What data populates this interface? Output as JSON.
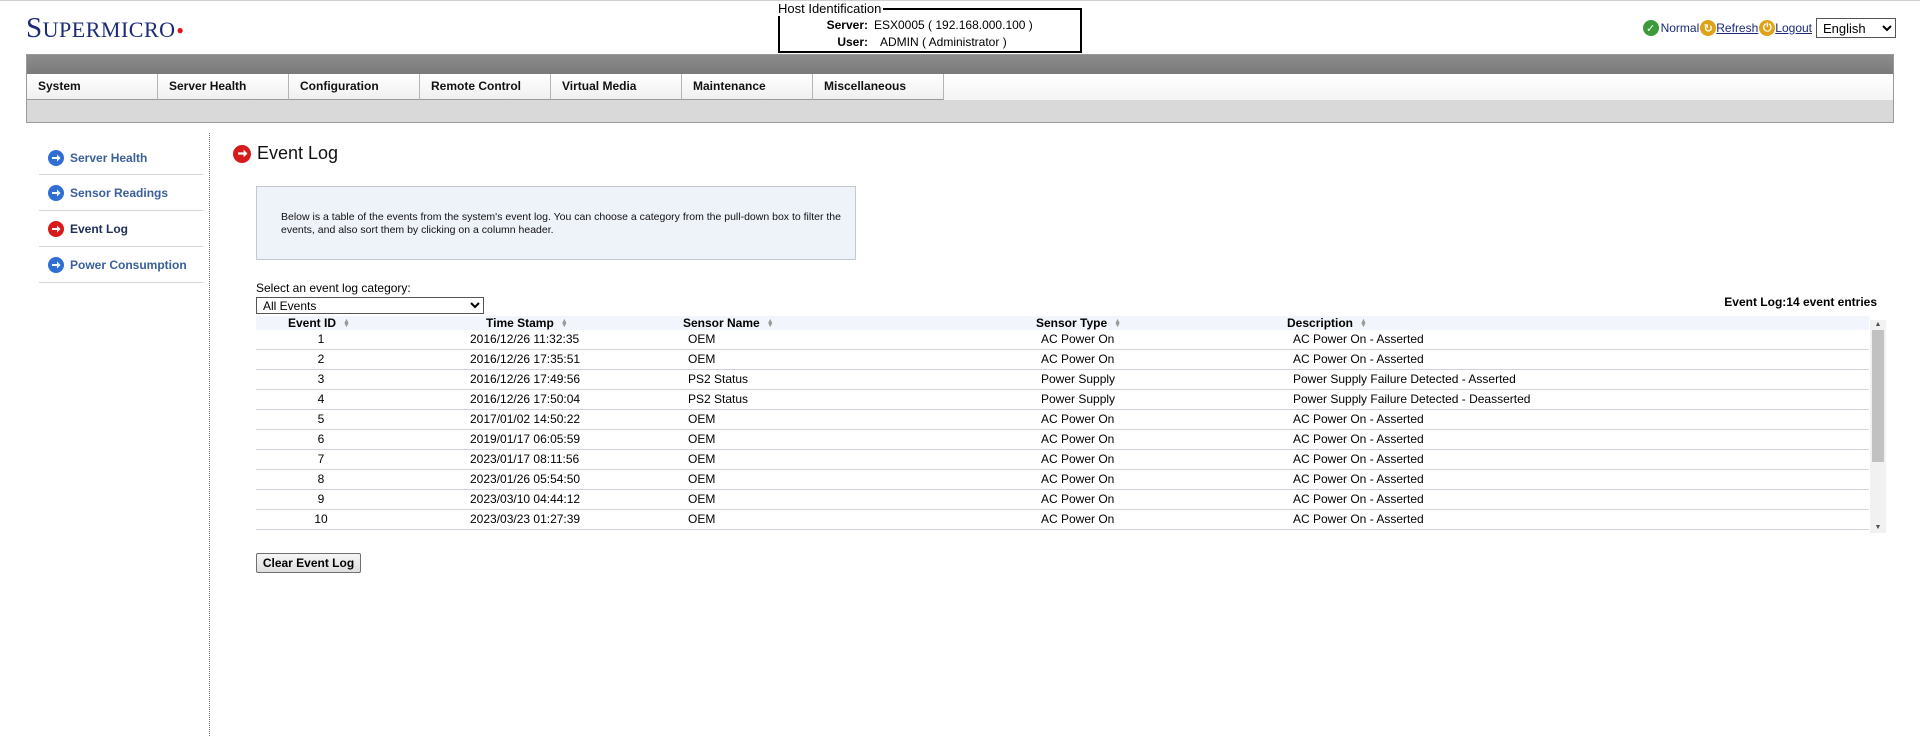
{
  "header": {
    "logo_text": "SUPERMICRO",
    "host": {
      "legend": "Host Identification",
      "server_label": "Server:",
      "server_value": "ESX0005  ( 192.168.000.100 )",
      "user_label": "User:",
      "user_value": "ADMIN      ( Administrator )"
    },
    "status_label": "Normal",
    "refresh_label": "Refresh",
    "logout_label": "Logout",
    "language": "English"
  },
  "nav": {
    "tabs": [
      "System",
      "Server Health",
      "Configuration",
      "Remote Control",
      "Virtual Media",
      "Maintenance",
      "Miscellaneous"
    ]
  },
  "sidebar": {
    "items": [
      {
        "label": "Server Health",
        "active": false
      },
      {
        "label": "Sensor Readings",
        "active": false
      },
      {
        "label": "Event Log",
        "active": true
      },
      {
        "label": "Power Consumption",
        "active": false
      }
    ]
  },
  "main": {
    "title": "Event Log",
    "info": "Below is a table of the events from the system's event log. You can choose a category from the pull-down box to filter the events, and also sort them by clicking on a column header.",
    "category_label": "Select an event log category:",
    "category_selected": "All Events",
    "entry_count": "Event Log:14 event entries",
    "columns": [
      "Event ID",
      "Time Stamp",
      "Sensor Name",
      "Sensor Type",
      "Description"
    ],
    "rows": [
      {
        "id": "1",
        "ts": "2016/12/26 11:32:35",
        "sensor": "OEM",
        "type": "AC Power On",
        "desc": "AC Power On - Asserted"
      },
      {
        "id": "2",
        "ts": "2016/12/26 17:35:51",
        "sensor": "OEM",
        "type": "AC Power On",
        "desc": "AC Power On - Asserted"
      },
      {
        "id": "3",
        "ts": "2016/12/26 17:49:56",
        "sensor": "PS2 Status",
        "type": "Power Supply",
        "desc": "Power Supply Failure Detected - Asserted"
      },
      {
        "id": "4",
        "ts": "2016/12/26 17:50:04",
        "sensor": "PS2 Status",
        "type": "Power Supply",
        "desc": "Power Supply Failure Detected - Deasserted"
      },
      {
        "id": "5",
        "ts": "2017/01/02 14:50:22",
        "sensor": "OEM",
        "type": "AC Power On",
        "desc": "AC Power On - Asserted"
      },
      {
        "id": "6",
        "ts": "2019/01/17 06:05:59",
        "sensor": "OEM",
        "type": "AC Power On",
        "desc": "AC Power On - Asserted"
      },
      {
        "id": "7",
        "ts": "2023/01/17 08:11:56",
        "sensor": "OEM",
        "type": "AC Power On",
        "desc": "AC Power On - Asserted"
      },
      {
        "id": "8",
        "ts": "2023/01/26 05:54:50",
        "sensor": "OEM",
        "type": "AC Power On",
        "desc": "AC Power On - Asserted"
      },
      {
        "id": "9",
        "ts": "2023/03/10 04:44:12",
        "sensor": "OEM",
        "type": "AC Power On",
        "desc": "AC Power On - Asserted"
      },
      {
        "id": "10",
        "ts": "2023/03/23 01:27:39",
        "sensor": "OEM",
        "type": "AC Power On",
        "desc": "AC Power On - Asserted"
      }
    ],
    "clear_button": "Clear Event Log"
  },
  "colors": {
    "brand_blue": "#1c2a78",
    "brand_red": "#e3101a",
    "link_blue": "#3a5f9a",
    "arrow_blue": "#2f6fd4",
    "arrow_red": "#d71a1a",
    "nav_gray": "#d9d9d9"
  }
}
